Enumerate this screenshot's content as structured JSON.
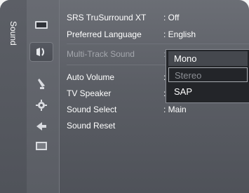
{
  "sidebar": {
    "tab_label": "Sound"
  },
  "icons": [
    {
      "name": "picture-icon"
    },
    {
      "name": "sound-icon"
    },
    {
      "name": "channel-icon"
    },
    {
      "name": "setup-icon"
    },
    {
      "name": "input-icon"
    },
    {
      "name": "application-icon"
    }
  ],
  "menu": {
    "rows": [
      {
        "label": "SRS TruSurround XT",
        "value": ": Off"
      },
      {
        "label": "Preferred Language",
        "value": ": English"
      },
      {
        "label": "Multi-Track Sound",
        "value": ":"
      },
      {
        "label": "Auto Volume",
        "value": ":"
      },
      {
        "label": "TV Speaker",
        "value": ":"
      },
      {
        "label": "Sound Select",
        "value": ": Main"
      },
      {
        "label": "Sound Reset",
        "value": ""
      }
    ]
  },
  "dropdown": {
    "options": [
      {
        "label": "Mono"
      },
      {
        "label": "Stereo"
      },
      {
        "label": "SAP"
      }
    ]
  }
}
